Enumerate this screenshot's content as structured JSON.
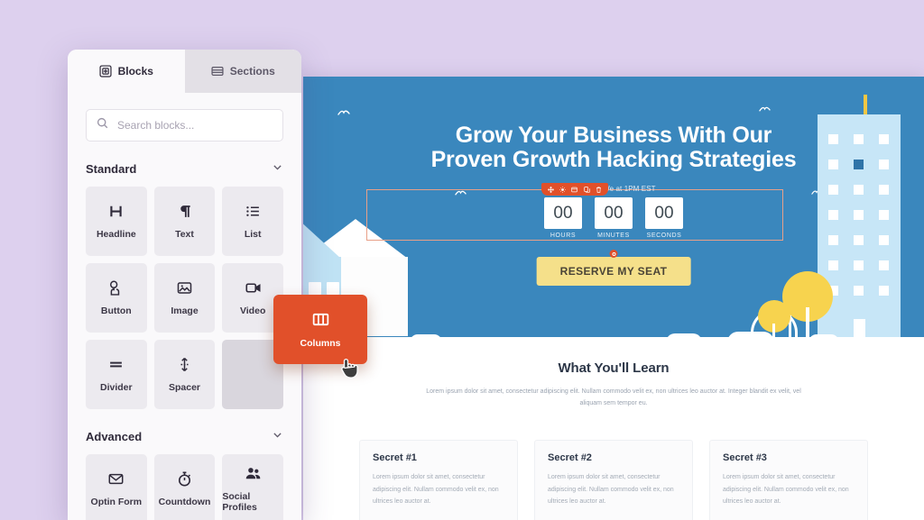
{
  "background_color": "#ddd0ee",
  "panel": {
    "tabs": [
      {
        "label": "Blocks",
        "icon": "blocks-icon",
        "active": true
      },
      {
        "label": "Sections",
        "icon": "sections-icon",
        "active": false
      }
    ],
    "search": {
      "placeholder": "Search blocks...",
      "value": "",
      "icon": "search-icon"
    },
    "groups": [
      {
        "title": "Standard",
        "chevron": "chevron-down-icon",
        "items": [
          {
            "label": "Headline",
            "icon": "headline-icon"
          },
          {
            "label": "Text",
            "icon": "paragraph-icon"
          },
          {
            "label": "List",
            "icon": "list-icon"
          },
          {
            "label": "Button",
            "icon": "button-icon"
          },
          {
            "label": "Image",
            "icon": "image-icon"
          },
          {
            "label": "Video",
            "icon": "video-icon"
          },
          {
            "label": "Divider",
            "icon": "divider-icon"
          },
          {
            "label": "Spacer",
            "icon": "spacer-icon"
          },
          {
            "label": "",
            "icon": "empty-slot"
          }
        ]
      },
      {
        "title": "Advanced",
        "chevron": "chevron-down-icon",
        "items": [
          {
            "label": "Optin Form",
            "icon": "envelope-icon"
          },
          {
            "label": "Countdown",
            "icon": "stopwatch-icon"
          },
          {
            "label": "Social Profiles",
            "icon": "people-icon"
          }
        ]
      }
    ]
  },
  "drag": {
    "label": "Columns",
    "icon": "columns-icon",
    "color": "#e1502a",
    "cursor": "pointing-hand-cursor"
  },
  "canvas": {
    "hero": {
      "background_color": "#3a87bd",
      "headline_line1": "Grow Your Business With Our",
      "headline_line2": "Proven Growth Hacking Strategies",
      "subtitle": "Join Us - We                    at 1PM EST",
      "countdown": [
        {
          "value": "00",
          "label": "HOURS"
        },
        {
          "value": "00",
          "label": "MINUTES"
        },
        {
          "value": "00",
          "label": "SECONDS"
        }
      ],
      "cta_label": "RESERVE MY SEAT",
      "cta_color": "#f5e08a",
      "element_toolbar": {
        "color": "#e1502a",
        "icons": [
          "move-icon",
          "settings-icon",
          "save-template-icon",
          "duplicate-icon",
          "delete-icon"
        ]
      }
    },
    "learn": {
      "heading": "What You'll Learn",
      "lead": "Lorem ipsum dolor sit amet, consectetur adipiscing elit. Nullam commodo velit ex, non ultrices leo auctor at. Integer blandit ex velit, vel aliquam sem tempor eu.",
      "cards": [
        {
          "title": "Secret #1",
          "body": "Lorem ipsum dolor sit amet, consectetur adipiscing elit. Nullam commodo velit ex, non ultrices leo auctor at."
        },
        {
          "title": "Secret #2",
          "body": "Lorem ipsum dolor sit amet, consectetur adipiscing elit. Nullam commodo velit ex, non ultrices leo auctor at."
        },
        {
          "title": "Secret #3",
          "body": "Lorem ipsum dolor sit amet, consectetur adipiscing elit. Nullam commodo velit ex, non ultrices leo auctor at."
        }
      ]
    }
  }
}
